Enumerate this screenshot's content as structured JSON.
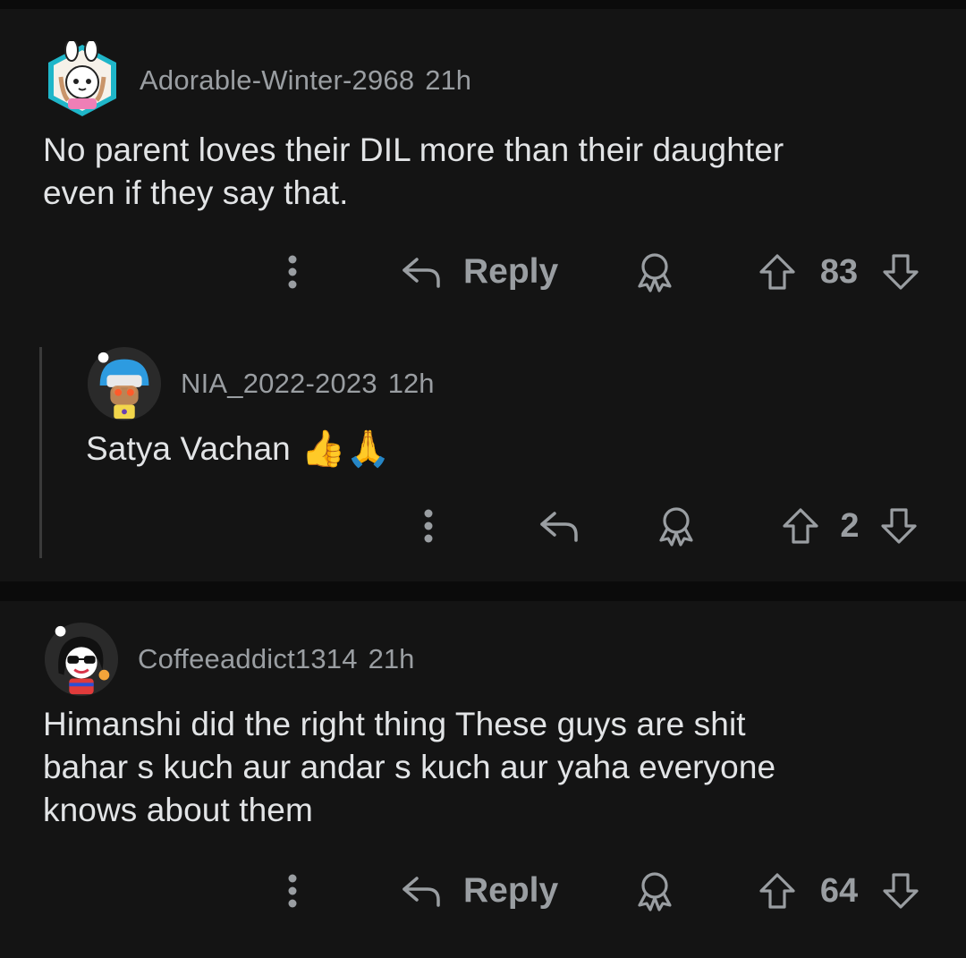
{
  "comments": [
    {
      "username": "Adorable-Winter-2968",
      "time": "21h",
      "body_lines": [
        "No parent loves their DIL more than their daughter",
        "even if they say that."
      ],
      "reply_label": "Reply",
      "score": "83",
      "avatar": "bunny-hood-avatar"
    },
    {
      "username": "NIA_2022-2023",
      "time": "12h",
      "body_text": "Satya Vachan",
      "emojis": "👍🙏",
      "score": "2",
      "avatar": "helmet-avatar"
    },
    {
      "username": "Coffeeaddict1314",
      "time": "21h",
      "body_lines": [
        "Himanshi did the right thing These guys are shit",
        "bahar s kuch aur andar s kuch aur yaha everyone",
        "knows about them"
      ],
      "reply_label": "Reply",
      "score": "64",
      "avatar": "sunglasses-avatar"
    }
  ],
  "icons": {
    "more": "more-options-icon",
    "reply": "reply-arrow-icon",
    "award": "award-icon",
    "upvote": "upvote-icon",
    "downvote": "downvote-icon"
  },
  "colors": {
    "background": "#141414",
    "separator": "#0b0b0b",
    "meta_text": "#9a9ea2",
    "body_text": "#e2e4e6"
  }
}
